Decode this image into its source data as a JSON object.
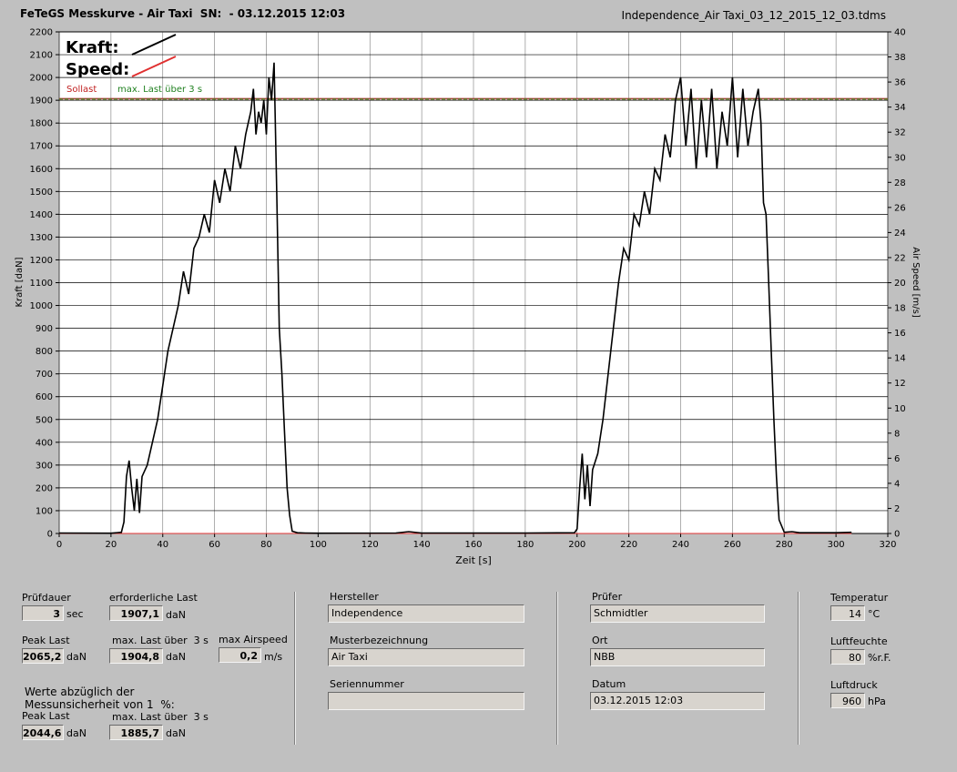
{
  "header": {
    "title": "FeTeGS Messkurve - Air Taxi  SN:  - 03.12.2015 12:03",
    "filename": "Independence_Air Taxi_03_12_2015_12_03.tdms"
  },
  "chart_data": {
    "type": "line",
    "xlabel": "Zeit [s]",
    "ylabel": "Kraft [daN]",
    "y2label": "Air Speed [m/s]",
    "xlim": [
      0,
      320
    ],
    "ylim": [
      0,
      2200
    ],
    "y2lim": [
      0,
      40
    ],
    "x_ticks": [
      "0",
      "20",
      "40",
      "60",
      "80",
      "100",
      "120",
      "140",
      "160",
      "180",
      "200",
      "220",
      "240",
      "260",
      "280",
      "300",
      "320"
    ],
    "y_ticks": [
      "0",
      "100",
      "200",
      "300",
      "400",
      "500",
      "600",
      "700",
      "800",
      "900",
      "1000",
      "1100",
      "1200",
      "1300",
      "1400",
      "1500",
      "1600",
      "1700",
      "1800",
      "1900",
      "2000",
      "2100",
      "2200"
    ],
    "y2_ticks": [
      "0",
      "2",
      "4",
      "6",
      "8",
      "10",
      "12",
      "14",
      "16",
      "18",
      "20",
      "22",
      "24",
      "26",
      "28",
      "30",
      "32",
      "34",
      "36",
      "38",
      "40"
    ],
    "grid": true,
    "legend": {
      "kraft": "Kraft:",
      "speed": "Speed:"
    },
    "sollast_label": "Sollast",
    "maxlast_label": "max. Last über  3 s",
    "sollast_value": 1907.1,
    "maxlast_value": 1904.8,
    "series": [
      {
        "name": "Kraft",
        "color": "#000000",
        "x": [
          0,
          20,
          24,
          25,
          26,
          27,
          28,
          29,
          30,
          31,
          32,
          34,
          36,
          38,
          40,
          42,
          44,
          46,
          48,
          50,
          52,
          54,
          56,
          58,
          60,
          62,
          64,
          66,
          68,
          70,
          72,
          74,
          75,
          76,
          77,
          78,
          79,
          80,
          81,
          82,
          83,
          84,
          85,
          86,
          87,
          88,
          89,
          90,
          92,
          95,
          100,
          130,
          135,
          140,
          180,
          199,
          200,
          201,
          202,
          203,
          204,
          205,
          206,
          208,
          210,
          212,
          214,
          216,
          218,
          220,
          222,
          224,
          226,
          228,
          230,
          232,
          234,
          236,
          238,
          240,
          242,
          244,
          246,
          248,
          250,
          252,
          254,
          256,
          258,
          260,
          262,
          264,
          266,
          268,
          270,
          271,
          272,
          273,
          274,
          275,
          276,
          277,
          278,
          280,
          283,
          286,
          300,
          306
        ],
        "y": [
          2,
          1,
          5,
          50,
          250,
          320,
          200,
          100,
          240,
          90,
          250,
          300,
          400,
          500,
          650,
          800,
          900,
          1000,
          1150,
          1050,
          1250,
          1300,
          1400,
          1320,
          1550,
          1450,
          1600,
          1500,
          1700,
          1600,
          1750,
          1850,
          1950,
          1750,
          1850,
          1800,
          1900,
          1750,
          2000,
          1900,
          2065,
          1500,
          900,
          700,
          450,
          200,
          80,
          10,
          3,
          2,
          1,
          2,
          8,
          2,
          2,
          3,
          20,
          200,
          350,
          150,
          300,
          120,
          280,
          350,
          500,
          700,
          900,
          1100,
          1250,
          1200,
          1400,
          1350,
          1500,
          1400,
          1600,
          1550,
          1750,
          1650,
          1900,
          2000,
          1700,
          1950,
          1600,
          1900,
          1650,
          1950,
          1600,
          1850,
          1700,
          2000,
          1650,
          1950,
          1700,
          1850,
          1950,
          1800,
          1450,
          1400,
          1100,
          800,
          500,
          250,
          60,
          5,
          8,
          3,
          3,
          5
        ]
      },
      {
        "name": "Speed",
        "color": "#e03030",
        "x": [
          0,
          306
        ],
        "y": [
          0,
          0
        ]
      }
    ]
  },
  "fields": {
    "pruefdauer": {
      "label": "Prüfdauer",
      "value": "3",
      "unit": "sec"
    },
    "erf_last": {
      "label": "erforderliche Last",
      "value": "1907,1",
      "unit": "daN"
    },
    "peak_last": {
      "label": "Peak Last",
      "value": "2065,2",
      "unit": "daN"
    },
    "max_last": {
      "label": "max. Last über  3 s",
      "value": "1904,8",
      "unit": "daN"
    },
    "max_airspeed": {
      "label": "max Airspeed",
      "value": "0,2",
      "unit": "m/s"
    },
    "werte_label": "Werte abzüglich der\nMessunsicherheit von 1  %:",
    "peak_last2": {
      "label": "Peak Last",
      "value": "2044,6",
      "unit": "daN"
    },
    "max_last2": {
      "label": "max. Last über  3 s",
      "value": "1885,7",
      "unit": "daN"
    },
    "hersteller": {
      "label": "Hersteller",
      "value": "Independence"
    },
    "muster": {
      "label": "Musterbezeichnung",
      "value": "Air Taxi"
    },
    "serien": {
      "label": "Seriennummer",
      "value": ""
    },
    "pruefer": {
      "label": "Prüfer",
      "value": "Schmidtler"
    },
    "ort": {
      "label": "Ort",
      "value": "NBB"
    },
    "datum": {
      "label": "Datum",
      "value": "03.12.2015 12:03"
    },
    "temperatur": {
      "label": "Temperatur",
      "value": "14",
      "unit": "°C"
    },
    "luftfeuchte": {
      "label": "Luftfeuchte",
      "value": "80",
      "unit": "%r.F."
    },
    "luftdruck": {
      "label": "Luftdruck",
      "value": "960",
      "unit": "hPa"
    }
  }
}
